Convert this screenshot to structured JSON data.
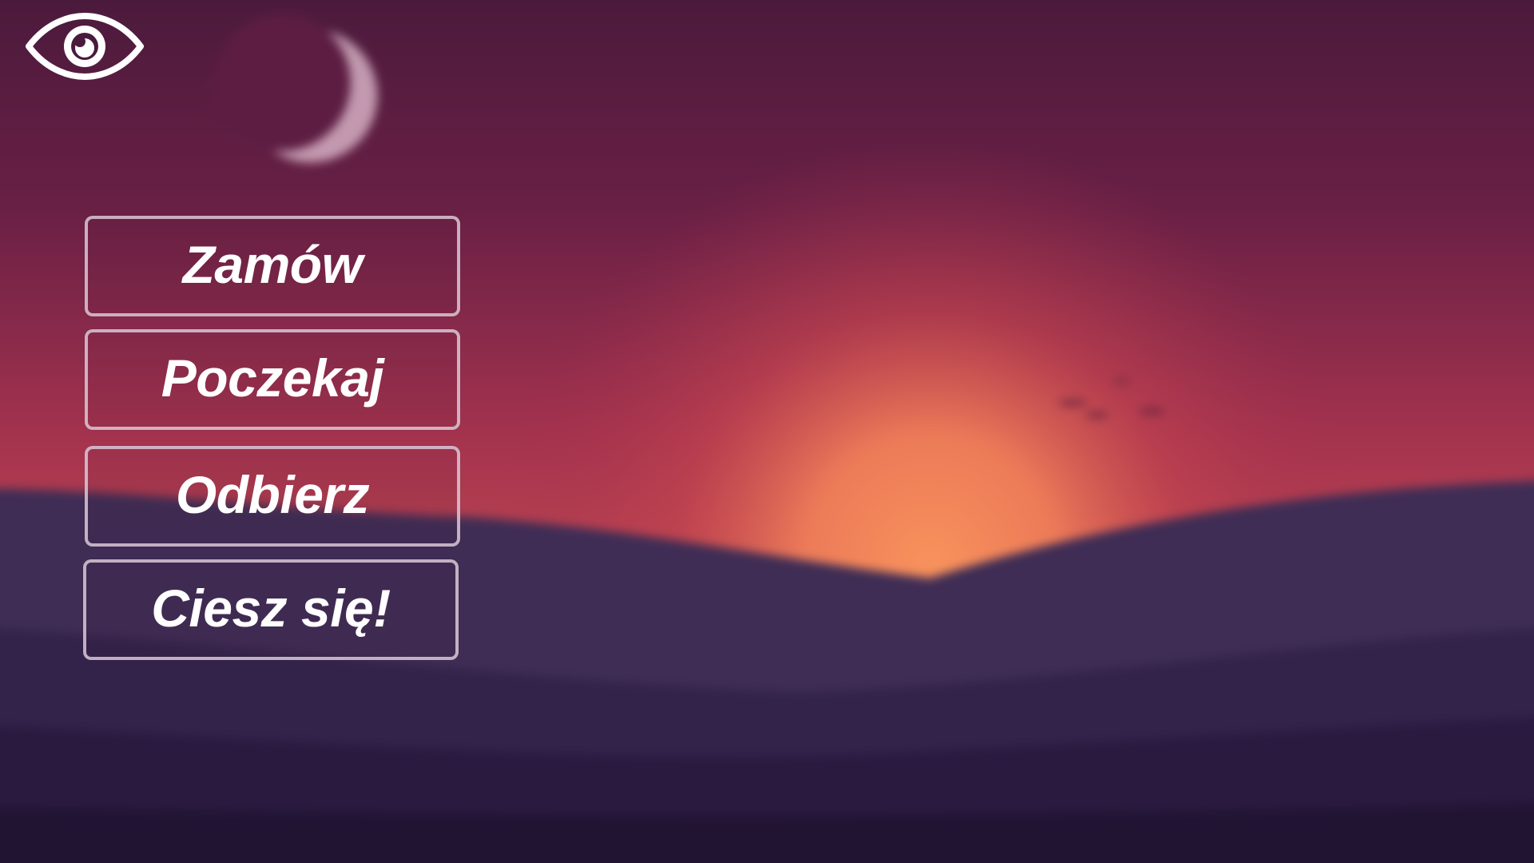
{
  "menu": {
    "items": [
      {
        "label": "Zamów"
      },
      {
        "label": "Poczekaj"
      },
      {
        "label": "Odbierz"
      },
      {
        "label": "Ciesz się!"
      }
    ]
  },
  "icons": {
    "visibility": "eye-icon"
  },
  "colors": {
    "sky_top": "#4a1a3c",
    "sky_mid": "#a3324e",
    "sun_glow": "#f5835a",
    "hills_near": "#3f2d55",
    "hills_dark": "#221535",
    "button_border": "#dcc8d7",
    "text": "#ffffff"
  }
}
